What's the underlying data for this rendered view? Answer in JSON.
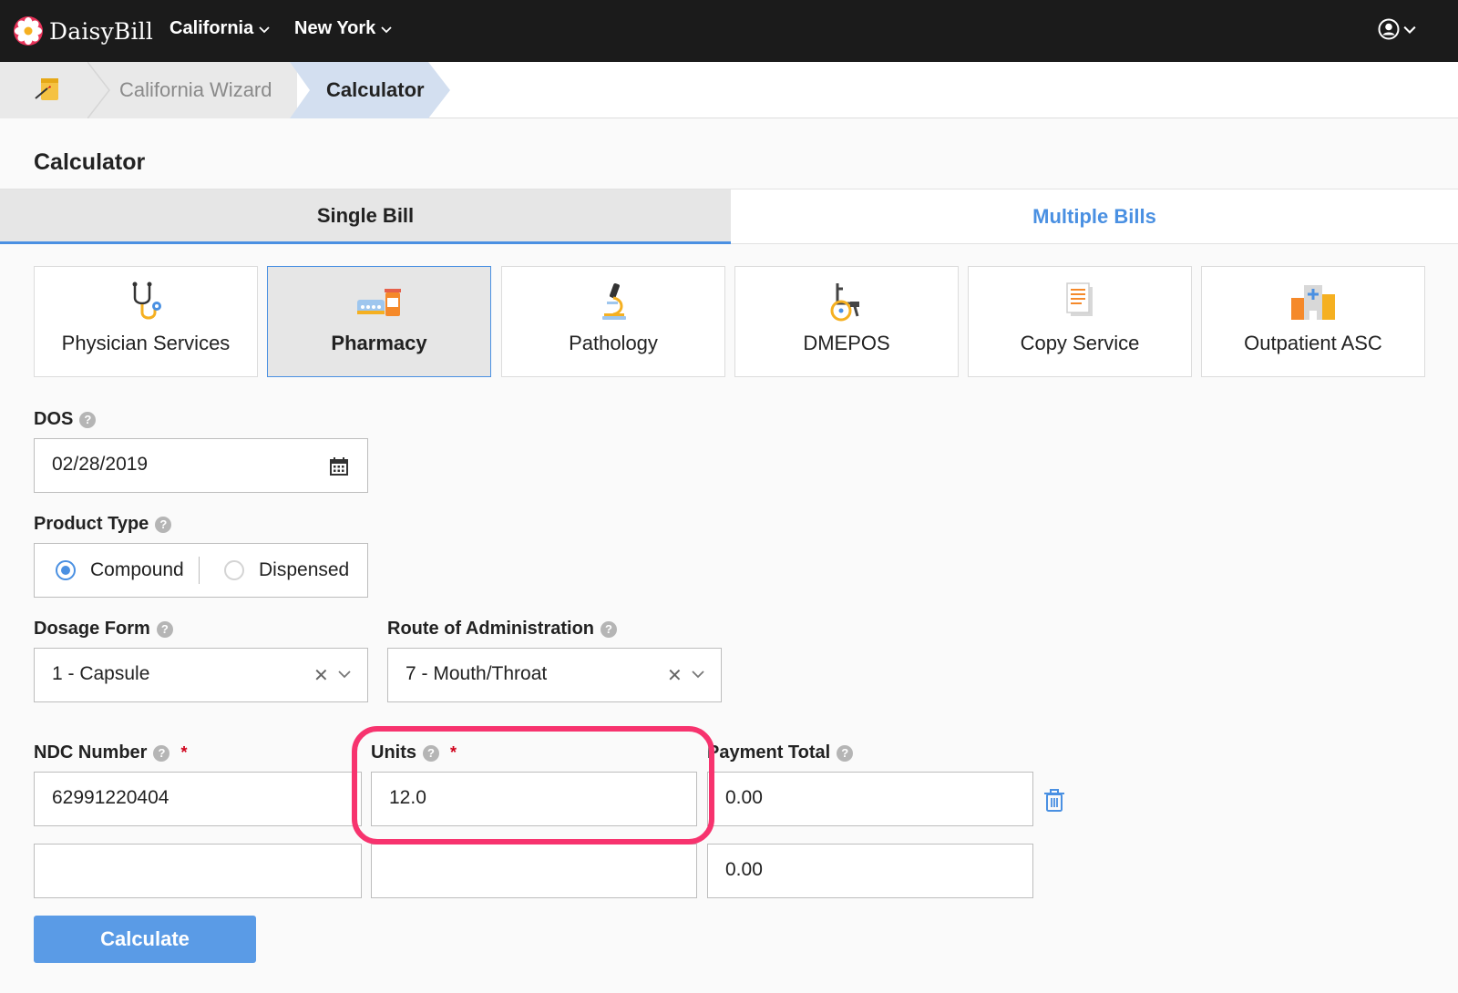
{
  "brand": {
    "name": "DaisyBill"
  },
  "nav": {
    "menus": [
      {
        "label": "California"
      },
      {
        "label": "New York"
      }
    ]
  },
  "breadcrumb": {
    "items": [
      {
        "label": "California Wizard"
      },
      {
        "label": "Calculator"
      }
    ]
  },
  "page": {
    "title": "Calculator"
  },
  "tabs": [
    {
      "label": "Single Bill",
      "active": true
    },
    {
      "label": "Multiple Bills",
      "active": false
    }
  ],
  "categories": [
    {
      "label": "Physician Services",
      "icon": "stethoscope-icon"
    },
    {
      "label": "Pharmacy",
      "icon": "pharmacy-icon",
      "active": true
    },
    {
      "label": "Pathology",
      "icon": "microscope-icon"
    },
    {
      "label": "DMEPOS",
      "icon": "wheelchair-icon"
    },
    {
      "label": "Copy Service",
      "icon": "document-icon"
    },
    {
      "label": "Outpatient ASC",
      "icon": "hospital-icon"
    }
  ],
  "form": {
    "dos": {
      "label": "DOS",
      "value": "02/28/2019"
    },
    "product_type": {
      "label": "Product Type",
      "options": [
        "Compound",
        "Dispensed"
      ],
      "selected": "Compound"
    },
    "dosage_form": {
      "label": "Dosage Form",
      "value": "1 - Capsule"
    },
    "route": {
      "label": "Route of Administration",
      "value": "7 - Mouth/Throat"
    },
    "ndc": {
      "label": "NDC Number"
    },
    "units": {
      "label": "Units"
    },
    "payment": {
      "label": "Payment Total"
    },
    "rows": [
      {
        "ndc": "62991220404",
        "units": "12.0",
        "payment": "0.00"
      },
      {
        "ndc": "",
        "units": "",
        "payment": "0.00"
      }
    ],
    "required_mark": "*"
  },
  "buttons": {
    "calculate": "Calculate"
  },
  "colors": {
    "accent": "#4a90e2",
    "highlight": "#f7336e",
    "topbar": "#1b1b1b"
  }
}
